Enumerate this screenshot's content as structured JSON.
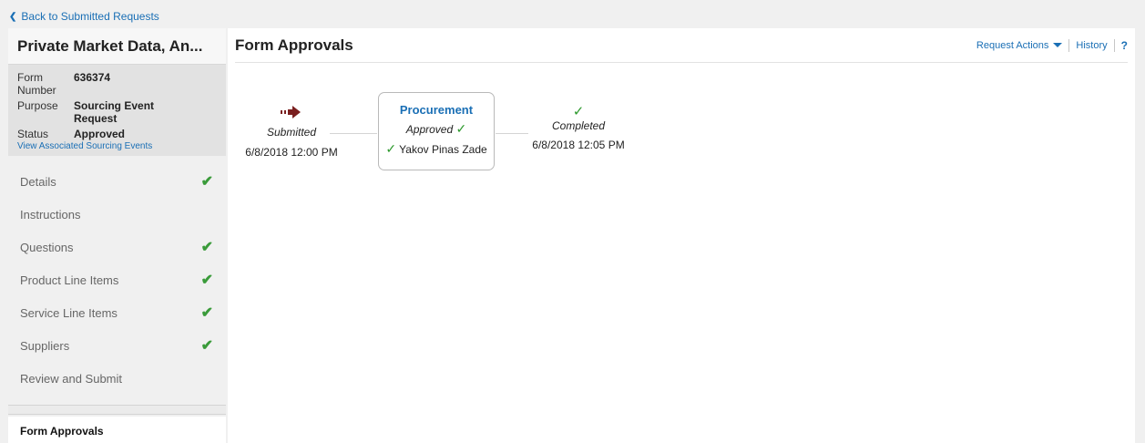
{
  "nav_back": {
    "label": "Back to Submitted Requests"
  },
  "sidebar": {
    "title": "Private Market Data, An...",
    "info": {
      "form_number_label": "Form Number",
      "form_number": "636374",
      "purpose_label": "Purpose",
      "purpose": "Sourcing Event Request",
      "status_label": "Status",
      "status": "Approved",
      "associated_link": "View Associated Sourcing Events"
    },
    "items": [
      {
        "label": "Details",
        "complete": true
      },
      {
        "label": "Instructions",
        "complete": false
      },
      {
        "label": "Questions",
        "complete": true
      },
      {
        "label": "Product Line Items",
        "complete": true
      },
      {
        "label": "Service Line Items",
        "complete": true
      },
      {
        "label": "Suppliers",
        "complete": true
      },
      {
        "label": "Review and Submit",
        "complete": false
      }
    ],
    "active_item": "Form Approvals"
  },
  "main": {
    "title": "Form Approvals",
    "actions": {
      "request_actions": "Request Actions",
      "history": "History",
      "help": "?"
    },
    "flow": {
      "submitted": {
        "stage": "Submitted",
        "time": "6/8/2018 12:00 PM"
      },
      "procurement": {
        "title": "Procurement",
        "status": "Approved",
        "approver": "Yakov Pinas Zade"
      },
      "completed": {
        "stage": "Completed",
        "time": "6/8/2018 12:05 PM"
      }
    }
  },
  "colors": {
    "link": "#1a6fb5",
    "check": "#3a9b3a",
    "arrow": "#7a1f1f"
  }
}
